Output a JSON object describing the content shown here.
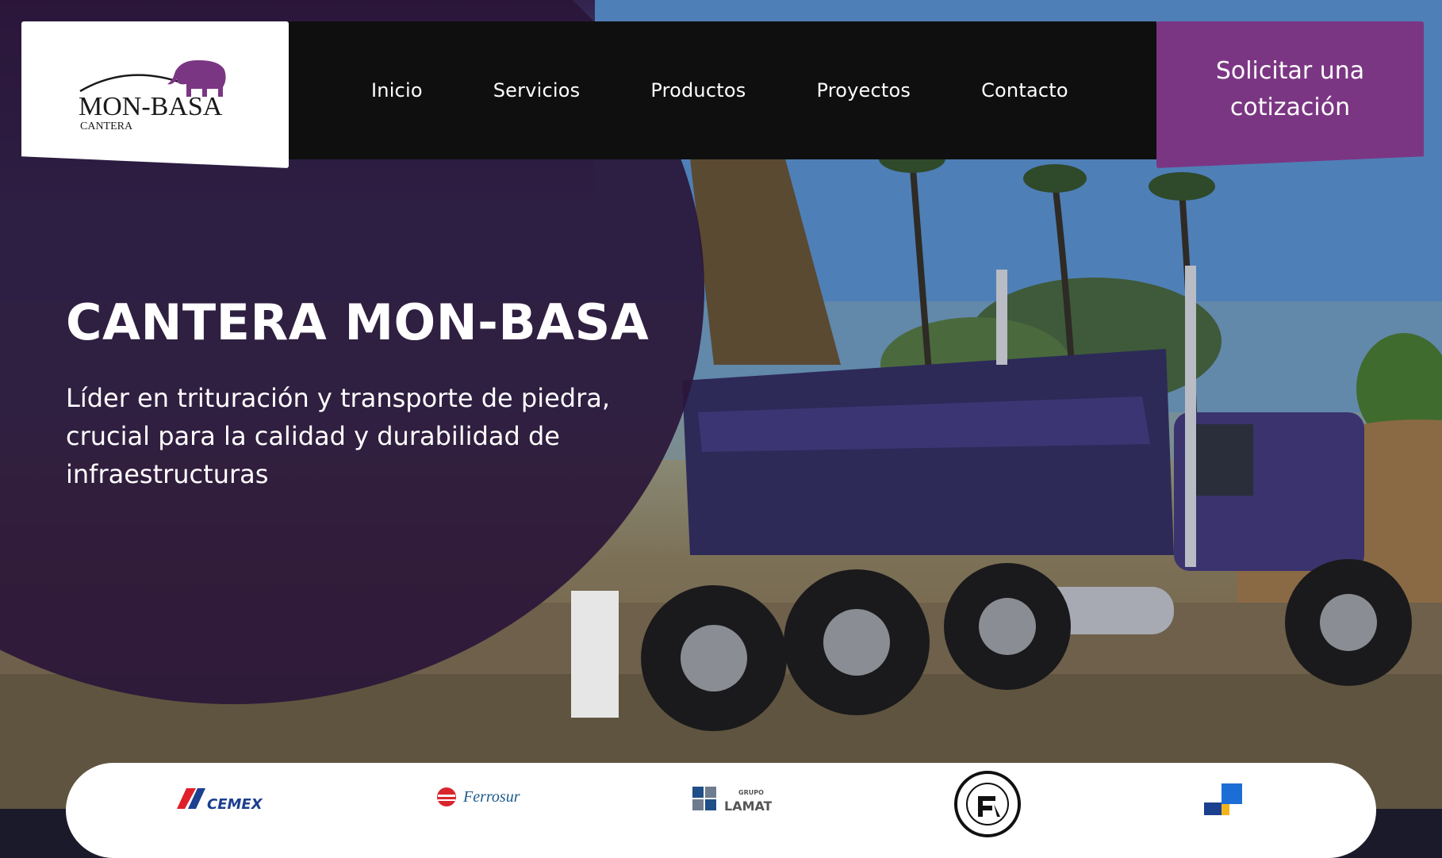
{
  "brand": {
    "name": "MON-BASA",
    "tagline": "CANTERA",
    "accent_color": "#7b3683"
  },
  "nav": {
    "items": [
      {
        "label": "Inicio"
      },
      {
        "label": "Servicios"
      },
      {
        "label": "Productos"
      },
      {
        "label": "Proyectos"
      },
      {
        "label": "Contacto"
      }
    ],
    "cta_label": "Solicitar una cotización"
  },
  "hero": {
    "title": "CANTERA MON-BASA",
    "subtitle": "Líder en trituración y transporte de piedra, crucial para la calidad y durabilidad de infraestructuras"
  },
  "partners": {
    "cemex_text": "CEMEX",
    "ferrosur_text": "Ferrosur",
    "lamat_small": "GRUPO",
    "lamat_text": "LAMAT"
  },
  "icons": [
    "elephant-logo-icon",
    "cemex-logo-icon",
    "ferrosur-logo-icon",
    "lamat-logo-icon",
    "concreto-seal-icon",
    "blue-squares-logo-icon"
  ]
}
